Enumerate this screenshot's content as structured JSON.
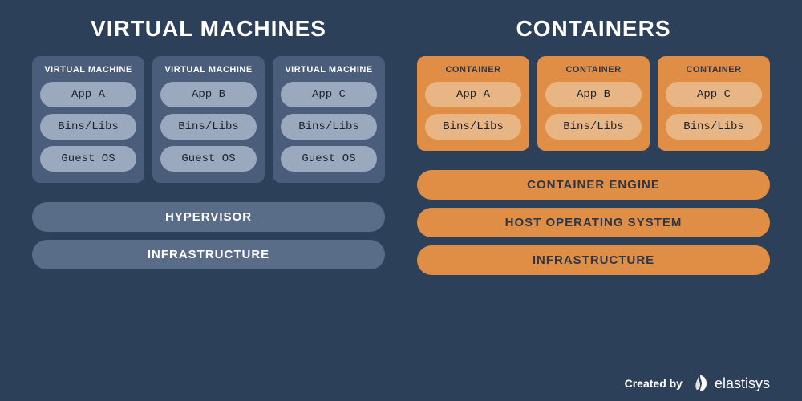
{
  "left": {
    "heading": "VIRTUAL MACHINES",
    "instances": [
      {
        "title": "VIRTUAL MACHINE",
        "layers": [
          "App A",
          "Bins/Libs",
          "Guest OS"
        ]
      },
      {
        "title": "VIRTUAL MACHINE",
        "layers": [
          "App B",
          "Bins/Libs",
          "Guest OS"
        ]
      },
      {
        "title": "VIRTUAL MACHINE",
        "layers": [
          "App C",
          "Bins/Libs",
          "Guest OS"
        ]
      }
    ],
    "stack": [
      "HYPERVISOR",
      "INFRASTRUCTURE"
    ]
  },
  "right": {
    "heading": "CONTAINERS",
    "instances": [
      {
        "title": "CONTAINER",
        "layers": [
          "App A",
          "Bins/Libs"
        ]
      },
      {
        "title": "CONTAINER",
        "layers": [
          "App B",
          "Bins/Libs"
        ]
      },
      {
        "title": "CONTAINER",
        "layers": [
          "App C",
          "Bins/Libs"
        ]
      }
    ],
    "stack": [
      "CONTAINER ENGINE",
      "HOST OPERATING SYSTEM",
      "INFRASTRUCTURE"
    ]
  },
  "footer": {
    "created_by": "Created by",
    "brand": "elastisys"
  }
}
